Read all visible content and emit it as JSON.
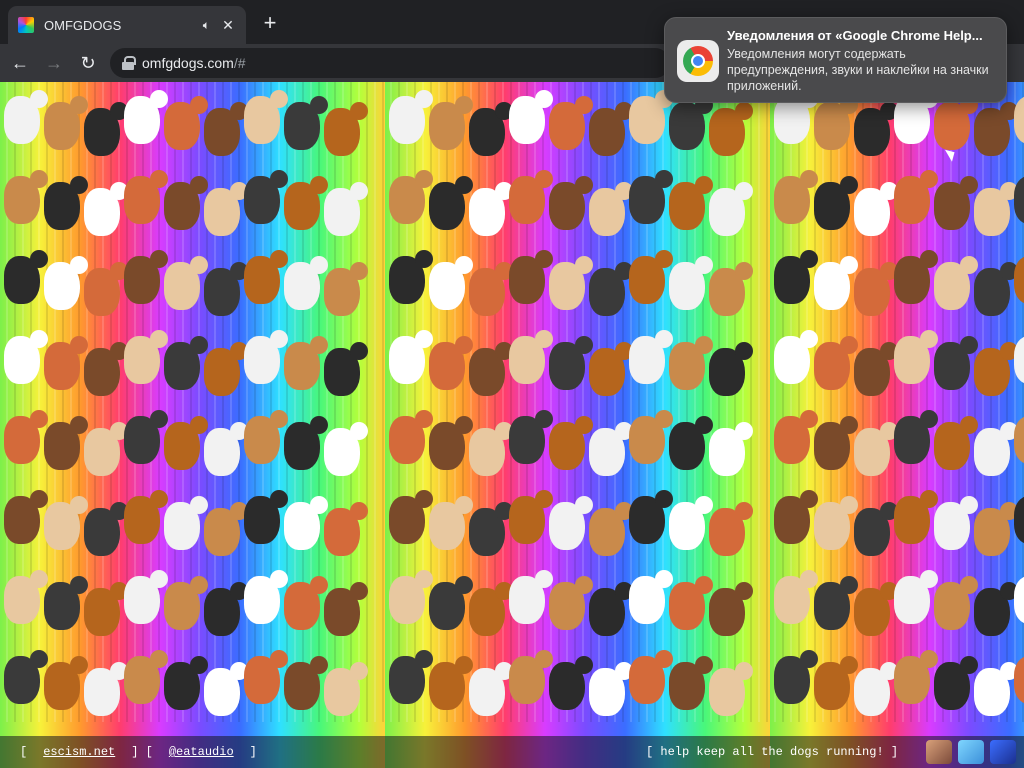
{
  "tab": {
    "title": "OMFGDOGS",
    "audio_icon": "speaker-icon",
    "close_icon": "close-icon"
  },
  "toolbar": {
    "url_host": "omfgdogs.com",
    "url_rest": "/#"
  },
  "footer": {
    "left_open": "[",
    "link1": "escism.net",
    "mid": "] [",
    "link2": "@eataudio",
    "left_close": "]",
    "right_text": "[ help keep all the dogs running! ]"
  },
  "notification": {
    "title": "Уведомления от «Google Chrome Help...",
    "body": "Уведомления могут содержать предупреждения, звуки и наклейки на значки приложений."
  },
  "colors": {
    "chrome_dark": "#202124",
    "chrome_toolbar": "#35363a",
    "notification_bg": "#4a4a4c"
  }
}
